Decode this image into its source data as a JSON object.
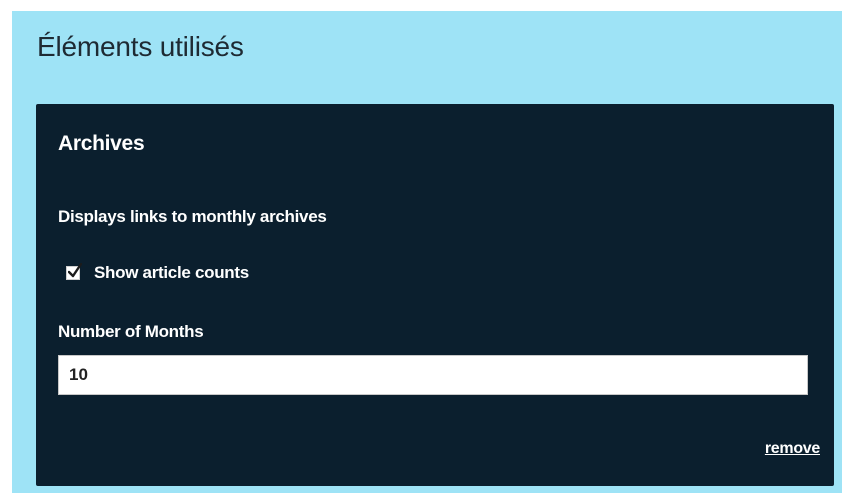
{
  "panel": {
    "title": "Éléments utilisés",
    "background_color": "#9ee3f6"
  },
  "widget": {
    "title": "Archives",
    "description": "Displays links to monthly archives",
    "background_color": "#0b1f2e",
    "show_counts": {
      "label": "Show article counts",
      "checked": true
    },
    "months_field": {
      "label": "Number of Months",
      "value": "10"
    },
    "remove_label": "remove"
  }
}
